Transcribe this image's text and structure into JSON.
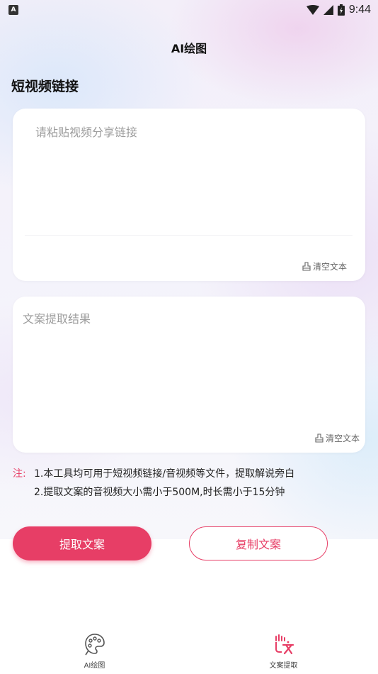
{
  "status_bar": {
    "notification_icon": "A",
    "time": "9:44"
  },
  "app_bar": {
    "title": "AI绘图"
  },
  "link_section": {
    "title": "短视频链接",
    "input_placeholder": "请粘贴视频分享链接",
    "clear_label": "清空文本"
  },
  "result_section": {
    "placeholder": "文案提取结果",
    "clear_label": "清空文本"
  },
  "note": {
    "label": "注:",
    "line1": "1.本工具均可用于短视频链接/音视频等文件，提取解说旁白",
    "line2": "2.提取文案的音视频大小需小于500M,时长需小于15分钟"
  },
  "buttons": {
    "extract": "提取文案",
    "copy": "复制文案"
  },
  "tabs": [
    {
      "label": "AI绘图",
      "icon": "palette-icon",
      "active": false
    },
    {
      "label": "文案提取",
      "icon": "text-extract-icon",
      "active": true
    }
  ],
  "colors": {
    "accent": "#e73e66",
    "note_label": "#e8456b"
  }
}
